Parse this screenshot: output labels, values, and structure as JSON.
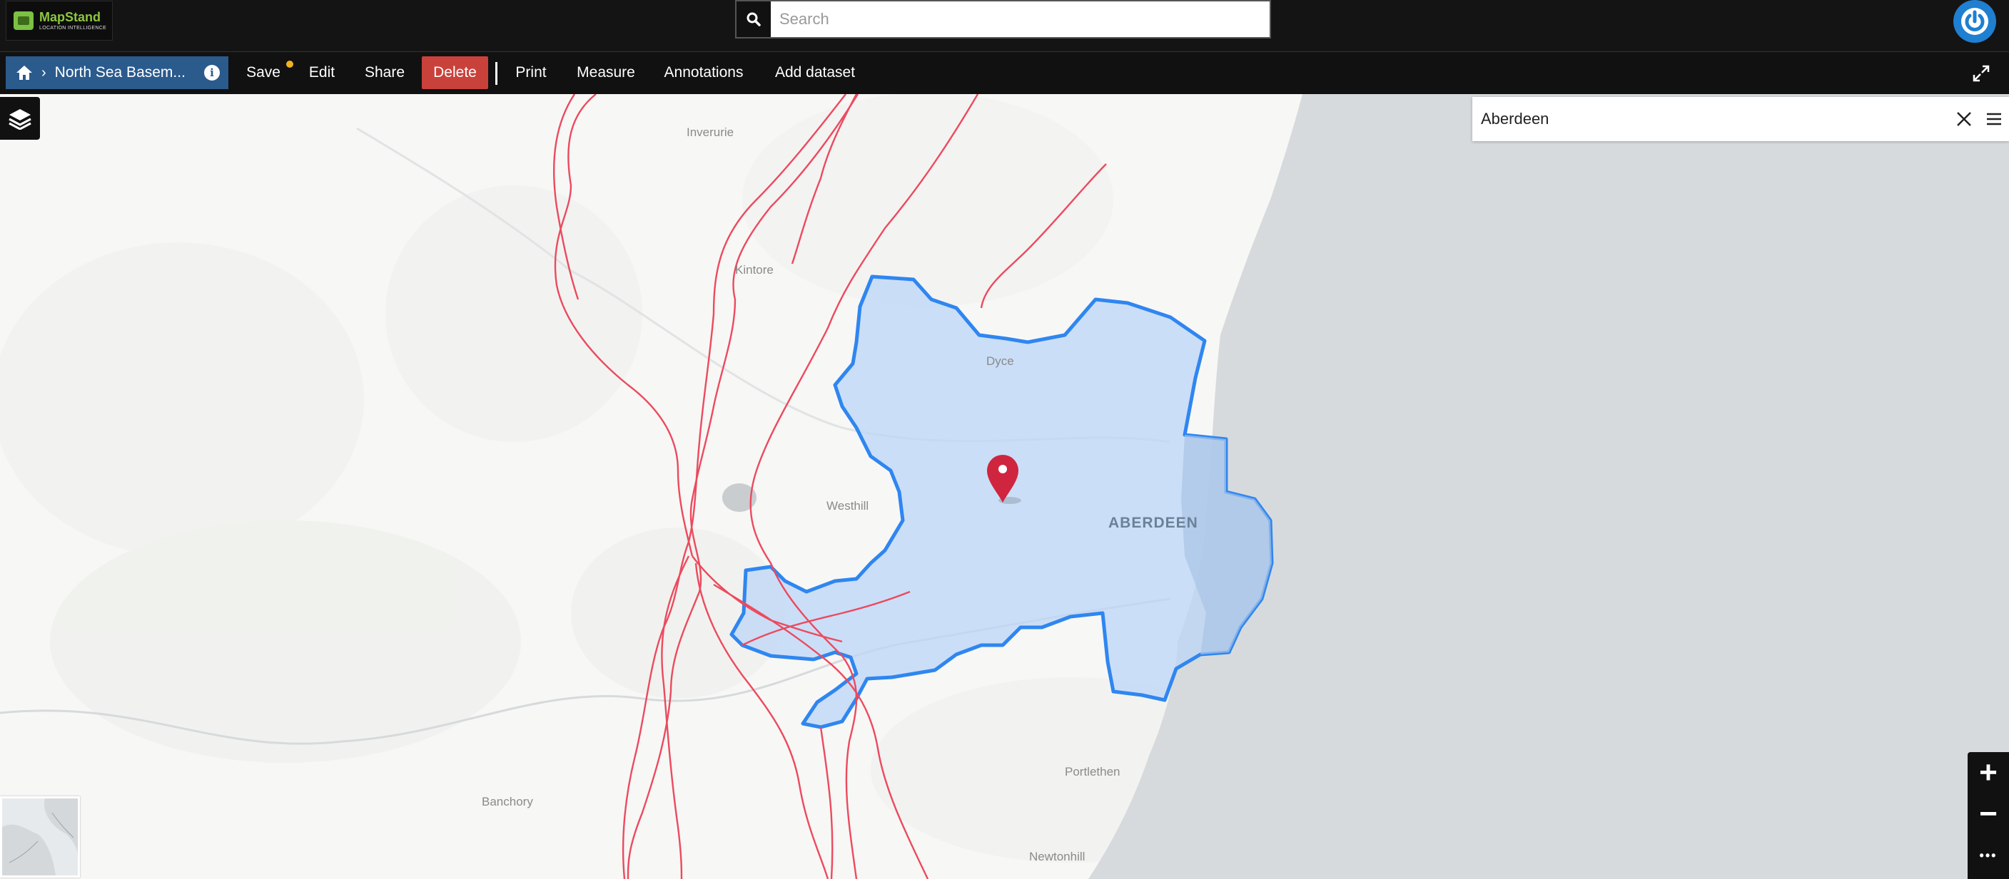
{
  "app": {
    "brand_name": "MapStand",
    "brand_tagline": "LOCATION INTELLIGENCE",
    "brand_color": "#8cc63f"
  },
  "search": {
    "placeholder": "Search",
    "value": ""
  },
  "toolbar": {
    "home_icon": "home-icon",
    "breadcrumb_title": "North Sea Basem...",
    "info_icon": "info-icon",
    "save_label": "Save",
    "edit_label": "Edit",
    "share_label": "Share",
    "delete_label": "Delete",
    "print_label": "Print",
    "measure_label": "Measure",
    "annotations_label": "Annotations",
    "add_dataset_label": "Add dataset",
    "colors": {
      "breadcrumb_bg": "#2b5a8c",
      "delete_bg": "#c9413b",
      "unsaved_dot": "#f1b31c"
    }
  },
  "geosearch": {
    "value": "Aberdeen",
    "clear_icon": "close-icon",
    "menu_icon": "hamburger-icon"
  },
  "map": {
    "places": {
      "inverurie": "Inverurie",
      "kintore": "Kintore",
      "dyce": "Dyce",
      "westhill": "Westhill",
      "aberdeen": "ABERDEEN",
      "banchory": "Banchory",
      "portlethen": "Portlethen",
      "newtonhill": "Newtonhill"
    },
    "boundary_color": "#2f86f0",
    "boundary_fill": "#bcd6f7",
    "road_color": "#ec4a5f",
    "marker_color": "#d0253f",
    "sea_color": "#d6dadd"
  },
  "zoom": {
    "in": "+",
    "out": "−",
    "more": "•••"
  }
}
